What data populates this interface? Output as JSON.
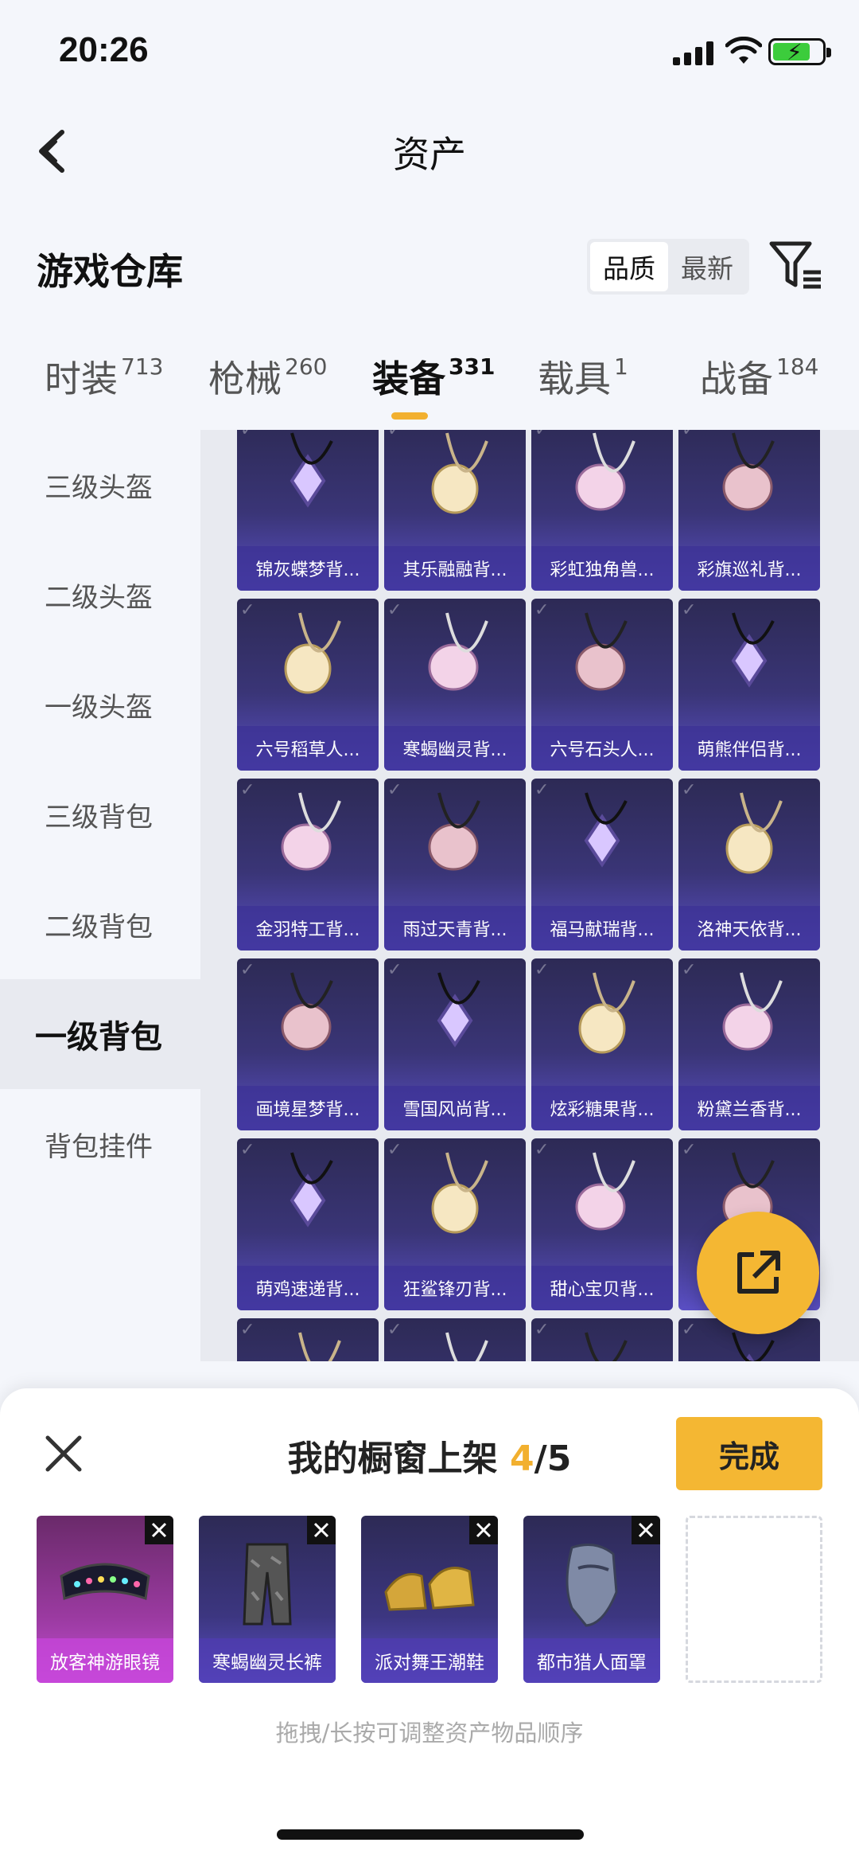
{
  "status": {
    "time": "20:26"
  },
  "nav": {
    "title": "资产"
  },
  "section": {
    "title": "游戏仓库",
    "sort_options": [
      "品质",
      "最新"
    ],
    "sort_active": 0
  },
  "tabs": [
    {
      "label": "时装",
      "count": "713"
    },
    {
      "label": "枪械",
      "count": "260"
    },
    {
      "label": "装备",
      "count": "331"
    },
    {
      "label": "载具",
      "count": "1"
    },
    {
      "label": "战备",
      "count": "184"
    }
  ],
  "active_tab": 2,
  "subnav": [
    "三级头盔",
    "二级头盔",
    "一级头盔",
    "三级背包",
    "二级背包",
    "一级背包",
    "背包挂件"
  ],
  "active_subnav": 5,
  "grid_items": [
    [
      "锦灰蝶梦背...",
      "其乐融融背...",
      "彩虹独角兽...",
      "彩旗巡礼背..."
    ],
    [
      "六号稻草人...",
      "寒蝎幽灵背...",
      "六号石头人...",
      "萌熊伴侣背..."
    ],
    [
      "金羽特工背...",
      "雨过天青背...",
      "福马献瑞背...",
      "洛神天依背..."
    ],
    [
      "画境星梦背...",
      "雪国风尚背...",
      "炫彩糖果背...",
      "粉黛兰香背..."
    ],
    [
      "萌鸡速递背...",
      "狂鲨锋刃背...",
      "甜心宝贝背...",
      ""
    ],
    [
      "",
      "",
      "",
      ""
    ]
  ],
  "panel": {
    "title": "我的橱窗上架",
    "count_current": "4",
    "count_total": "/5",
    "done_label": "完成",
    "slots": [
      "放客神游眼镜",
      "寒蝎幽灵长裤",
      "派对舞王潮鞋",
      "都市猎人面罩"
    ],
    "hint": "拖拽/长按可调整资产物品顺序"
  },
  "icons": {
    "back": "back-icon",
    "filter": "filter-icon",
    "share": "share-icon",
    "close": "close-icon",
    "remove": "remove-icon"
  },
  "colors": {
    "accent": "#f4b733",
    "card_top": "#2d2a55",
    "card_bottom": "#5a4fc4"
  }
}
